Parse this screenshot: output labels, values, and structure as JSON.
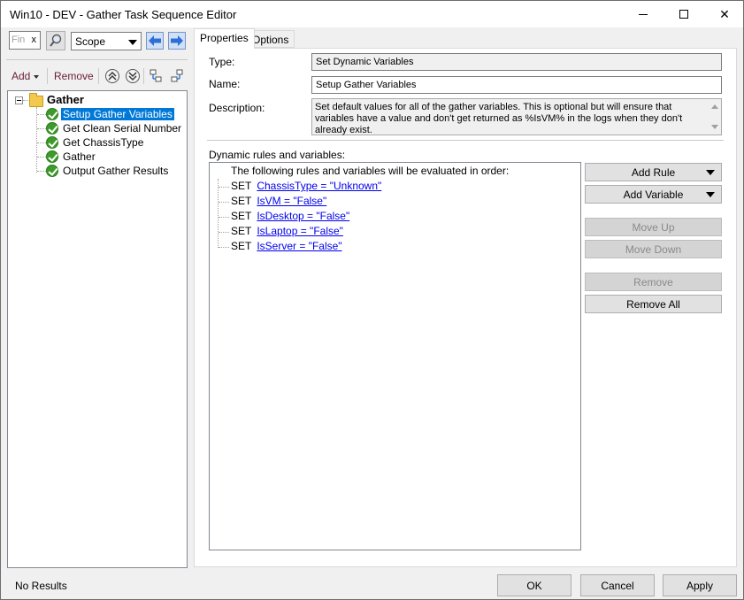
{
  "window": {
    "title": "Win10 - DEV - Gather Task Sequence Editor",
    "controls": {
      "minimize": "",
      "maximize": "",
      "close": "✕"
    }
  },
  "toolbar": {
    "find_placeholder": "Fin",
    "find_clear": "x",
    "scope_value": "Scope",
    "add_label": "Add",
    "remove_label": "Remove"
  },
  "tree": {
    "root_label": "Gather",
    "items": [
      {
        "label": "Setup Gather Variables",
        "selected": true
      },
      {
        "label": "Get Clean Serial Number",
        "selected": false
      },
      {
        "label": "Get ChassisType",
        "selected": false
      },
      {
        "label": "Gather",
        "selected": false
      },
      {
        "label": "Output Gather Results",
        "selected": false
      }
    ]
  },
  "tabs": [
    {
      "label": "Properties",
      "active": true
    },
    {
      "label": "Options",
      "active": false
    }
  ],
  "properties": {
    "type_label": "Type:",
    "type_value": "Set Dynamic Variables",
    "name_label": "Name:",
    "name_value": "Setup Gather Variables",
    "description_label": "Description:",
    "description_value": "Set default values for all of the gather variables. This is optional but will ensure that variables have a value and don't get returned as %IsVM% in the logs when they don't already exist.",
    "rules_heading": "Dynamic rules and variables:",
    "rules_intro": "The following rules and variables will be evaluated in order:",
    "rules": [
      {
        "keyword": "SET",
        "expression": "ChassisType = \"Unknown\""
      },
      {
        "keyword": "SET",
        "expression": "IsVM = \"False\""
      },
      {
        "keyword": "SET",
        "expression": "IsDesktop = \"False\""
      },
      {
        "keyword": "SET",
        "expression": "IsLaptop = \"False\""
      },
      {
        "keyword": "SET",
        "expression": "IsServer = \"False\""
      }
    ]
  },
  "rule_buttons": {
    "add_rule": "Add Rule",
    "add_variable": "Add Variable",
    "move_up": "Move Up",
    "move_down": "Move Down",
    "remove": "Remove",
    "remove_all": "Remove All"
  },
  "footer": {
    "status": "No Results",
    "ok": "OK",
    "cancel": "Cancel",
    "apply": "Apply"
  },
  "colors": {
    "selection": "#0078d7",
    "link": "#0000ee",
    "accent_text": "#6b1e36",
    "check_green": "#3c9b2b"
  }
}
